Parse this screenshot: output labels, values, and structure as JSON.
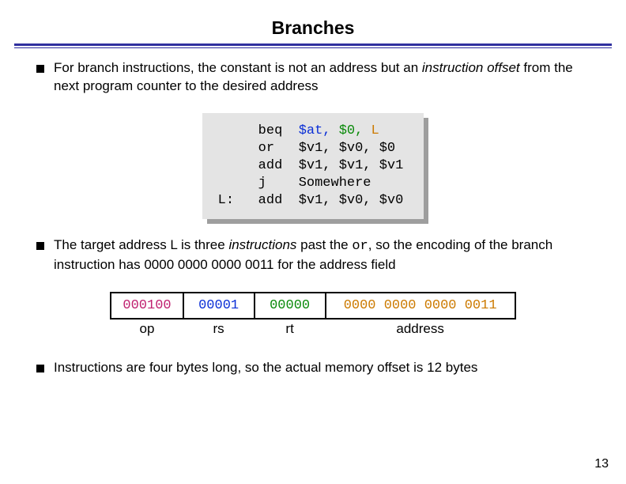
{
  "title": "Branches",
  "bullets": {
    "b1_pre": "For branch instructions, the constant is not an address but an ",
    "b1_em": "instruction offset",
    "b1_post": " from the next program counter to the desired address",
    "b2_pre": "The target address L is three ",
    "b2_em": "instructions",
    "b2_post1": " past the ",
    "b2_code": "or",
    "b2_post2": ", so the encoding of the branch instruction has 0000 0000 0000 0011 for the address field",
    "b3": "Instructions are four bytes long, so the actual memory offset is 12 bytes"
  },
  "code": {
    "line1": {
      "label": "",
      "op": "beq",
      "a1": "$at,",
      "a2": "$0,",
      "a3": "L"
    },
    "line2": {
      "label": "",
      "op": "or",
      "a1": "$v1,",
      "a2": "$v0,",
      "a3": "$0"
    },
    "line3": {
      "label": "",
      "op": "add",
      "a1": "$v1,",
      "a2": "$v1,",
      "a3": "$v1"
    },
    "line4": {
      "label": "",
      "op": "j",
      "a1": "Somewhere",
      "a2": "",
      "a3": ""
    },
    "line5": {
      "label": "L:",
      "op": "add",
      "a1": "$v1,",
      "a2": "$v0,",
      "a3": "$v0"
    }
  },
  "encoding": {
    "opcode": "000100",
    "rs": "00001",
    "rt": "00000",
    "address": "0000 0000 0000 0011",
    "lbl_op": "op",
    "lbl_rs": "rs",
    "lbl_rt": "rt",
    "lbl_addr": "address"
  },
  "pagenum": "13"
}
